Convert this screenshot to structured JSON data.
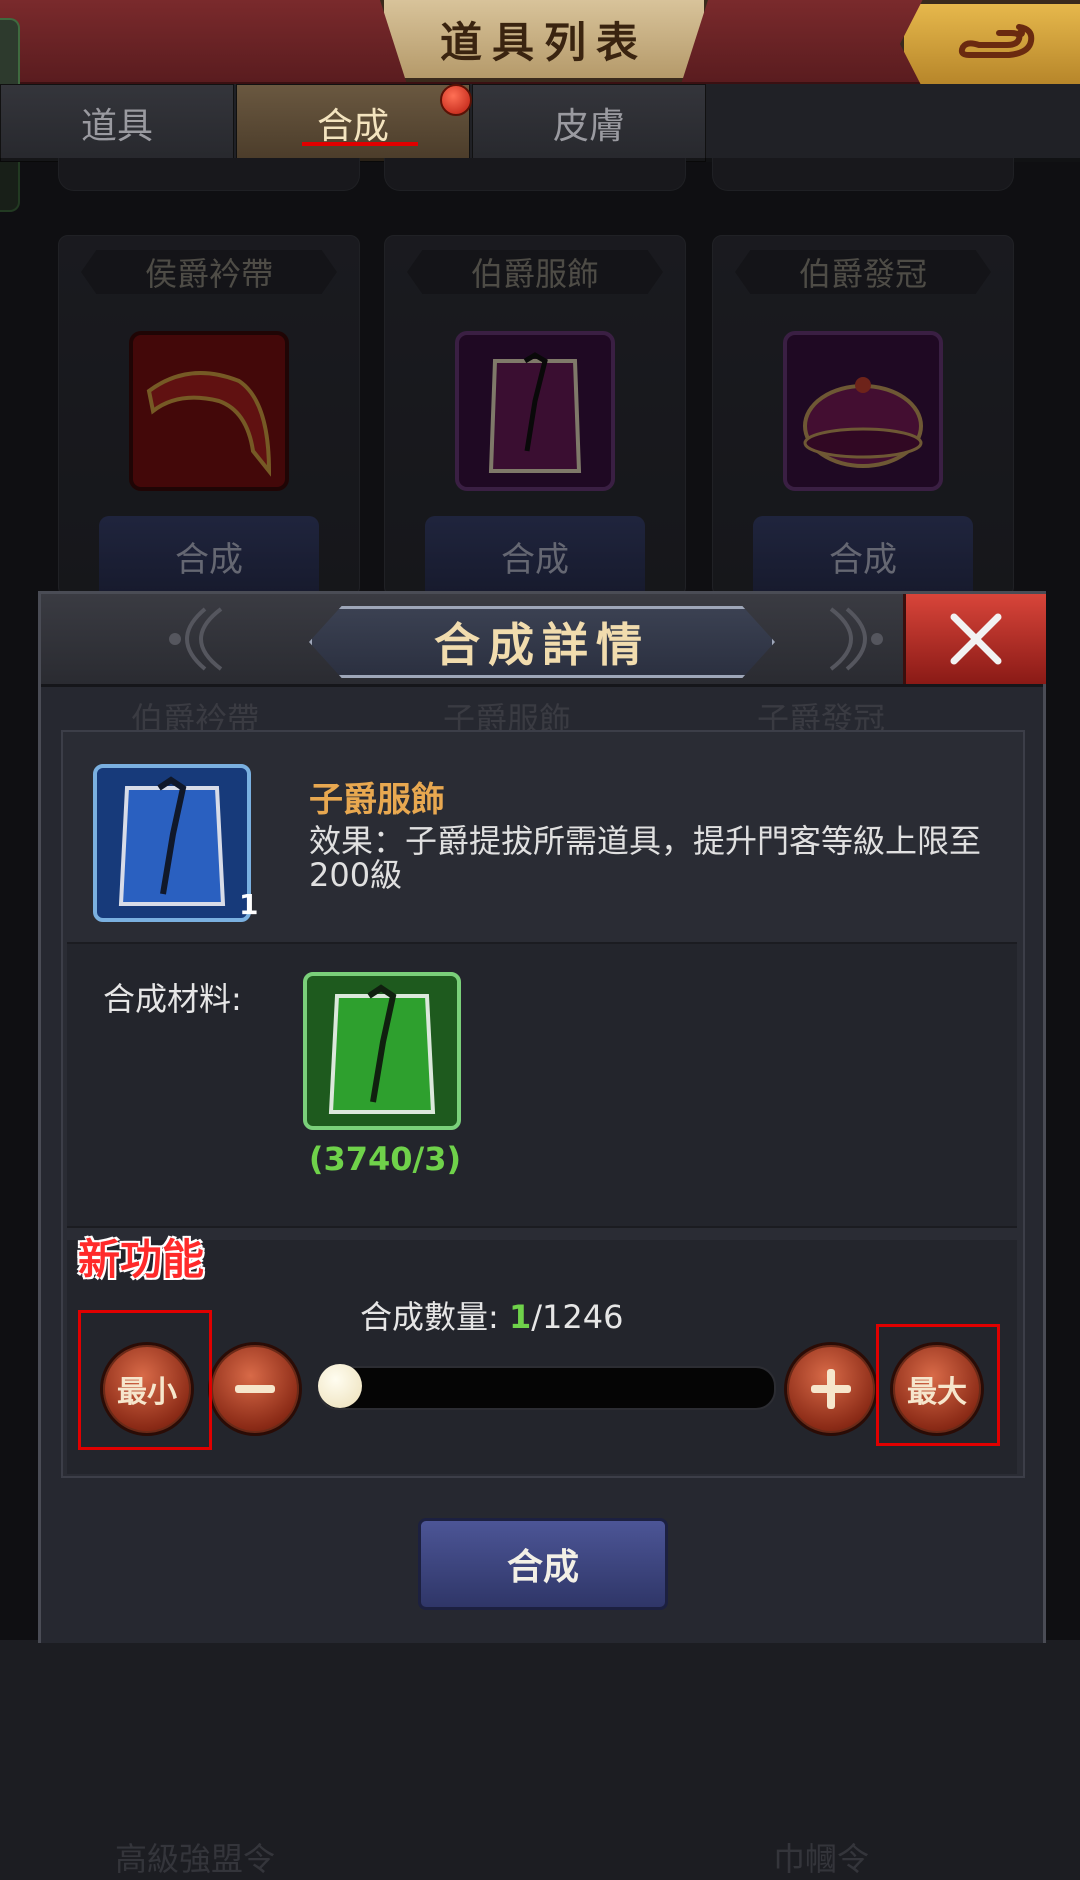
{
  "header": {
    "title": "道具列表"
  },
  "tabs": [
    {
      "label": "道具",
      "active": false
    },
    {
      "label": "合成",
      "active": true
    },
    {
      "label": "皮膚",
      "active": false
    }
  ],
  "list": {
    "cards": [
      {
        "name": "侯爵衿帶",
        "button": "合成",
        "icon": "collar-sash-icon"
      },
      {
        "name": "伯爵服飾",
        "button": "合成",
        "icon": "robe-icon"
      },
      {
        "name": "伯爵發冠",
        "button": "合成",
        "icon": "cap-icon"
      }
    ],
    "ghost_row": [
      "伯爵衿帶",
      "子爵服飾",
      "子爵發冠"
    ],
    "ghost_bottom": [
      "高級強盟令",
      "巾幗令"
    ]
  },
  "modal": {
    "title": "合成詳情",
    "item": {
      "name": "子爵服飾",
      "count": "1",
      "description": "效果：子爵提拔所需道具，提升門客等級上限至200級"
    },
    "materials": {
      "label": "合成材料:",
      "count": "(3740/3)"
    },
    "quantity": {
      "label": "合成數量:",
      "current": "1",
      "max": "/1246",
      "min_label": "最小",
      "max_label": "最大"
    },
    "annotation": "新功能",
    "craft_button": "合成"
  },
  "colors": {
    "accent_red": "#e00000",
    "item_name": "#e8a850",
    "material_count": "#6fd24a"
  }
}
